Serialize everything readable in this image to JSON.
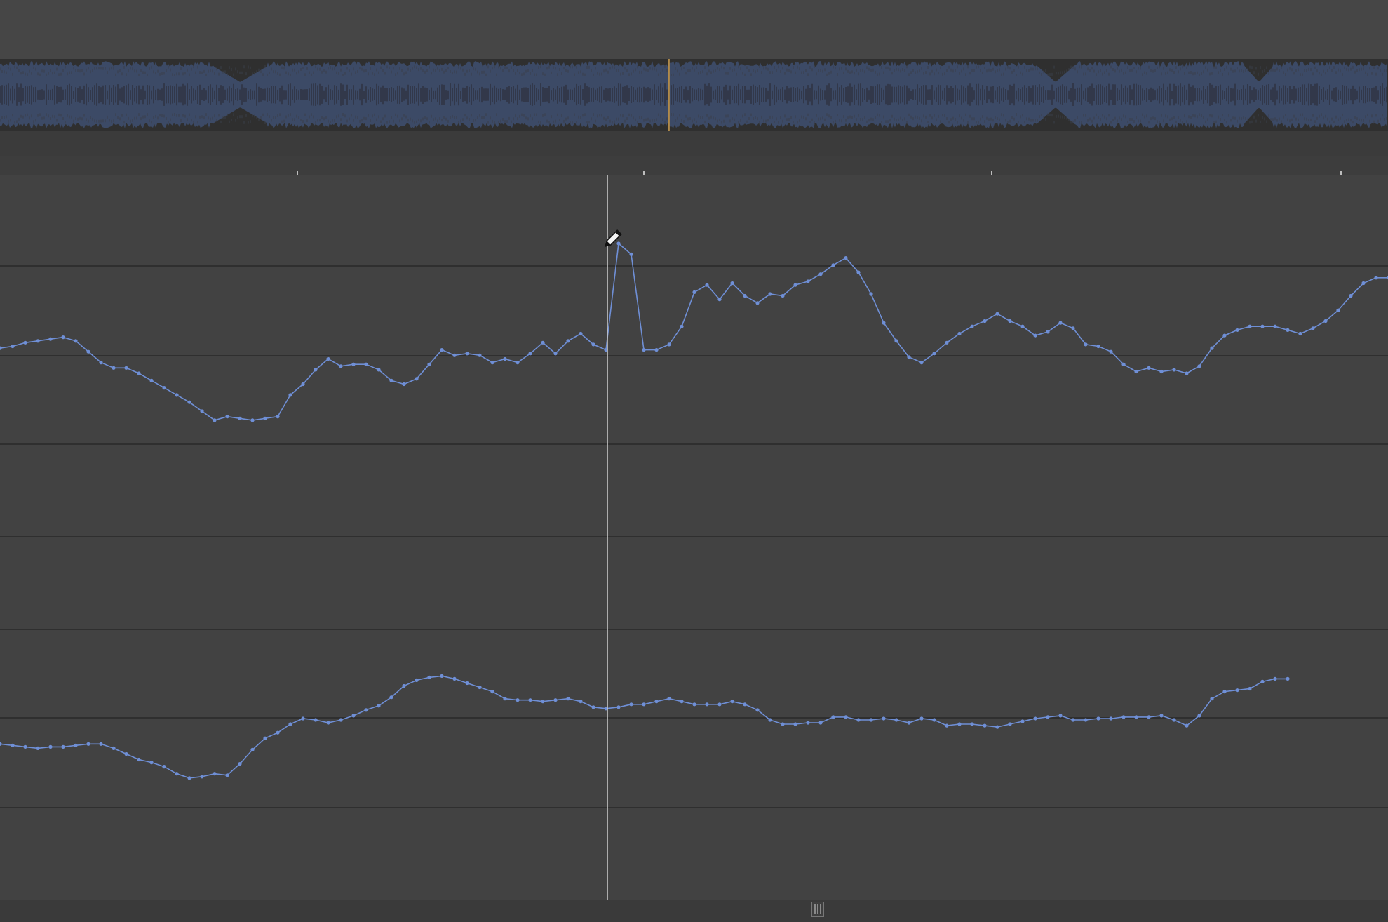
{
  "app": {
    "accent_color": "#6f8fd6",
    "waveform_color": "#3c4a66",
    "playhead_color": "#c8c8c8",
    "overview_marker_color": "#b08a4a"
  },
  "overview": {
    "marker_position": 0.482
  },
  "automation": {
    "cursor_icon": "pencil-icon",
    "lanes": [
      {
        "name": "",
        "points": [
          0.42,
          0.43,
          0.45,
          0.46,
          0.47,
          0.48,
          0.46,
          0.4,
          0.34,
          0.31,
          0.31,
          0.28,
          0.24,
          0.2,
          0.16,
          0.12,
          0.07,
          0.02,
          0.04,
          0.03,
          0.02,
          0.03,
          0.04,
          0.16,
          0.22,
          0.3,
          0.36,
          0.32,
          0.33,
          0.33,
          0.3,
          0.24,
          0.22,
          0.25,
          0.33,
          0.41,
          0.38,
          0.39,
          0.38,
          0.34,
          0.36,
          0.34,
          0.39,
          0.45,
          0.39,
          0.46,
          0.5,
          0.44,
          0.41,
          1.0,
          0.94,
          0.41,
          0.41,
          0.44,
          0.54,
          0.73,
          0.77,
          0.69,
          0.78,
          0.71,
          0.67,
          0.72,
          0.71,
          0.77,
          0.79,
          0.83,
          0.88,
          0.92,
          0.84,
          0.72,
          0.56,
          0.46,
          0.37,
          0.34,
          0.39,
          0.45,
          0.5,
          0.54,
          0.57,
          0.61,
          0.57,
          0.54,
          0.49,
          0.51,
          0.56,
          0.53,
          0.44,
          0.43,
          0.4,
          0.33,
          0.29,
          0.31,
          0.29,
          0.3,
          0.28,
          0.32,
          0.42,
          0.49,
          0.52,
          0.54,
          0.54,
          0.54,
          0.52,
          0.5,
          0.53,
          0.57,
          0.63,
          0.71,
          0.78,
          0.81,
          0.81,
          0.8
        ]
      },
      {
        "name": "",
        "points": [
          0.34,
          0.33,
          0.32,
          0.31,
          0.32,
          0.32,
          0.33,
          0.34,
          0.34,
          0.31,
          0.27,
          0.23,
          0.21,
          0.18,
          0.13,
          0.1,
          0.11,
          0.13,
          0.12,
          0.2,
          0.3,
          0.38,
          0.42,
          0.48,
          0.52,
          0.51,
          0.49,
          0.51,
          0.54,
          0.58,
          0.61,
          0.67,
          0.75,
          0.79,
          0.81,
          0.82,
          0.8,
          0.77,
          0.74,
          0.71,
          0.66,
          0.65,
          0.65,
          0.64,
          0.65,
          0.66,
          0.64,
          0.6,
          0.59,
          0.6,
          0.62,
          0.62,
          0.64,
          0.66,
          0.64,
          0.62,
          0.62,
          0.62,
          0.64,
          0.62,
          0.58,
          0.51,
          0.48,
          0.48,
          0.49,
          0.49,
          0.53,
          0.53,
          0.51,
          0.51,
          0.52,
          0.51,
          0.49,
          0.52,
          0.51,
          0.47,
          0.48,
          0.48,
          0.47,
          0.46,
          0.48,
          0.5,
          0.52,
          0.53,
          0.54,
          0.51,
          0.51,
          0.52,
          0.52,
          0.53,
          0.53,
          0.53,
          0.54,
          0.51,
          0.47,
          0.54,
          0.66,
          0.71,
          0.72,
          0.73,
          0.78,
          0.8,
          0.8
        ]
      }
    ]
  }
}
